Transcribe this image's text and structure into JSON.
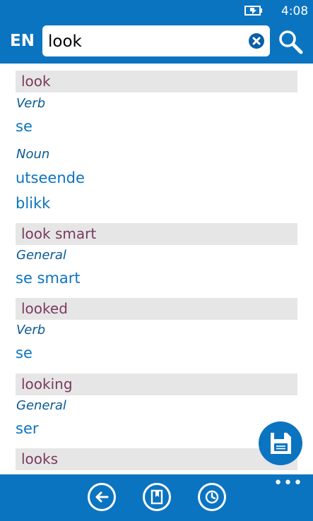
{
  "status": {
    "time": "4:08"
  },
  "header": {
    "lang": "EN",
    "search_value": "look"
  },
  "results": [
    {
      "headword": "look",
      "groups": [
        {
          "pos": "Verb",
          "translations": [
            "se"
          ]
        },
        {
          "pos": "Noun",
          "translations": [
            "utseende",
            "blikk"
          ]
        }
      ]
    },
    {
      "headword": "look smart",
      "groups": [
        {
          "pos": "General",
          "translations": [
            "se smart"
          ]
        }
      ]
    },
    {
      "headword": "looked",
      "groups": [
        {
          "pos": "Verb",
          "translations": [
            "se"
          ]
        }
      ]
    },
    {
      "headword": "looking",
      "groups": [
        {
          "pos": "General",
          "translations": [
            "ser"
          ]
        }
      ]
    },
    {
      "headword": "looks",
      "groups": []
    }
  ],
  "appbar": {
    "more_label": "•••"
  },
  "icons": {
    "battery": "battery-charging-icon",
    "clear": "clear-icon",
    "search": "search-icon",
    "save": "save-icon",
    "back": "back-arrow-icon",
    "book": "bookmark-book-icon",
    "history": "history-clock-icon"
  },
  "colors": {
    "primary": "#0b74c1",
    "headword": "#7a3a5e",
    "header_bg": "#e6e6e6",
    "pos": "#0a5a94"
  }
}
